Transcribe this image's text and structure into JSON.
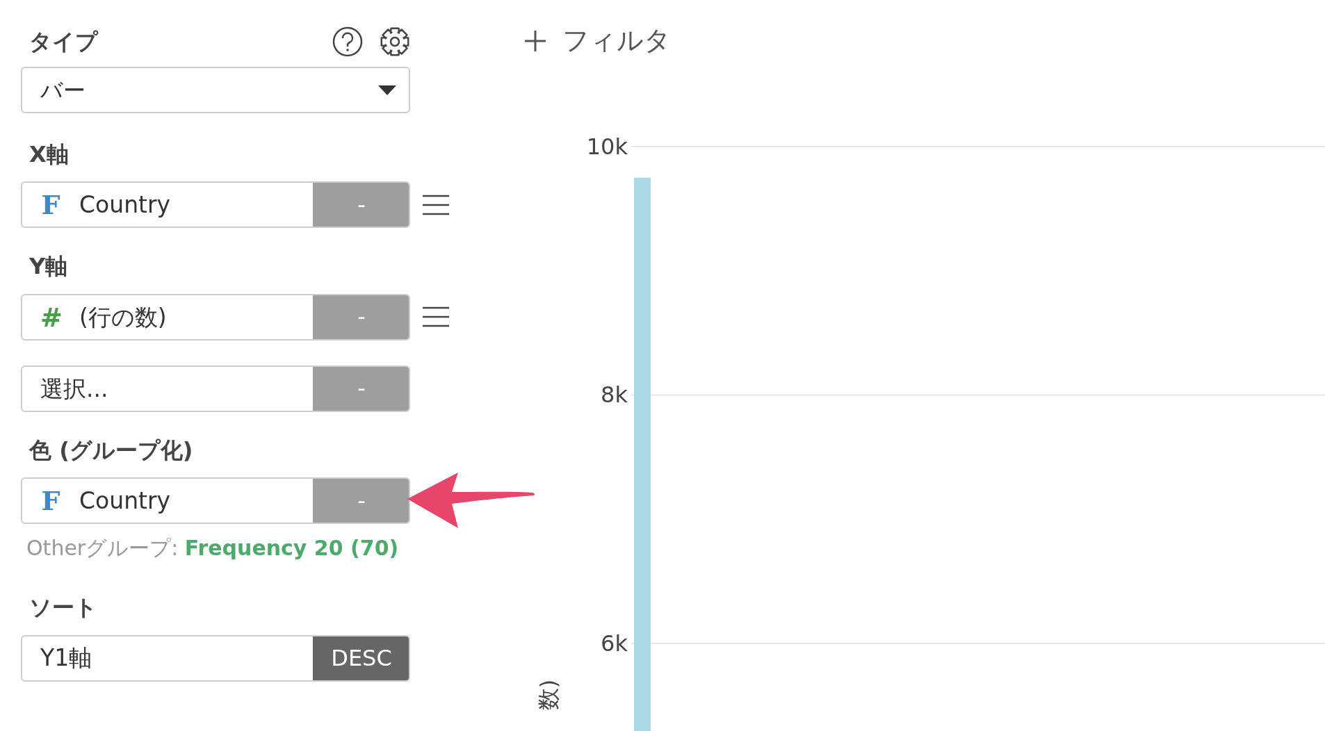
{
  "type_section": {
    "label": "タイプ",
    "select": {
      "value": "バー"
    }
  },
  "filter": {
    "label": "フィルタ"
  },
  "sections": [
    {
      "label": "X軸",
      "field": {
        "icon": "F",
        "color": "#3f88cc",
        "value": "Country",
        "button": {
          "label": "-",
          "kind": "remove"
        },
        "menu": true
      }
    },
    {
      "label": "Y軸",
      "field": {
        "icon": "#",
        "color": "#4a9e4a",
        "value": "(行の数)",
        "button": {
          "label": "-",
          "kind": "remove"
        },
        "menu": true
      }
    },
    {
      "field": {
        "value": "選択...",
        "button": {
          "label": "-",
          "kind": "remove"
        },
        "menu": false
      }
    },
    {
      "label": "色 (グループ化)",
      "field": {
        "icon": "F",
        "color": "#3f88cc",
        "value": "Country",
        "button": {
          "label": "-",
          "kind": "remove"
        },
        "menu": false,
        "annotated": true
      },
      "note": "Otherグループ: **Frequency 20 (70)**"
    },
    {
      "label": "ソート",
      "field": {
        "value": "Y1軸",
        "button": {
          "label": "DESC",
          "kind": "order"
        },
        "menu": false
      }
    }
  ],
  "chart": {
    "chart_data": {
      "type": "bar",
      "ylabel": "数)",
      "grid": true,
      "ylim": [
        5295,
        10000
      ],
      "yticks": [
        {
          "value": 6000,
          "label": "6k"
        },
        {
          "value": 8000,
          "label": "8k"
        },
        {
          "value": 10000,
          "label": "10k"
        }
      ],
      "series": [
        {
          "color": "#add8e6",
          "values": [
            9750
          ]
        }
      ]
    }
  }
}
